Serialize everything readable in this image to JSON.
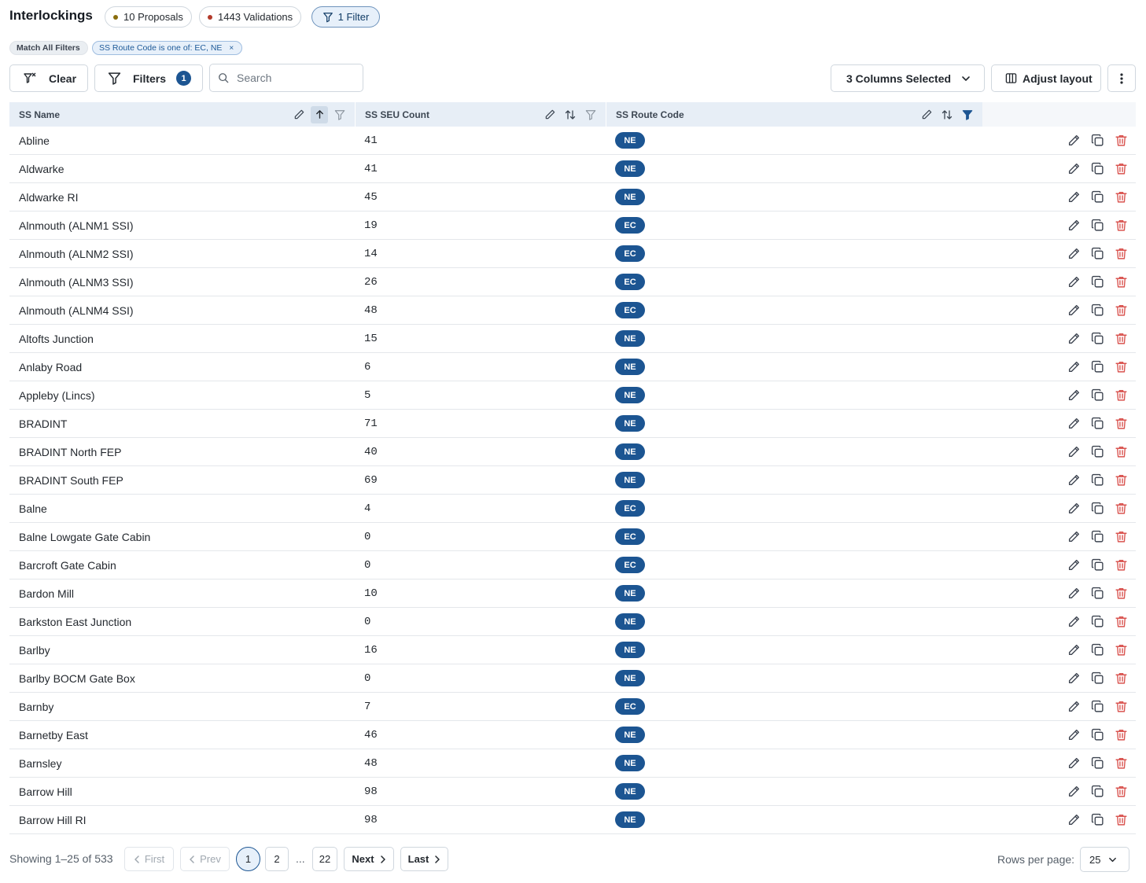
{
  "header": {
    "title": "Interlockings",
    "proposals_label": "10 Proposals",
    "proposals_color": "#8a6d0c",
    "validations_label": "1443 Validations",
    "validations_color": "#b33a2a",
    "filter_chip_label": "1 Filter"
  },
  "filter_pills": {
    "match_label": "Match All Filters",
    "active_filter": "SS Route Code is one of: EC, NE",
    "remove_symbol": "×"
  },
  "toolbar": {
    "clear_label": "Clear",
    "filters_label": "Filters",
    "filters_count": "1",
    "search_placeholder": "Search",
    "columns_label": "3 Columns Selected",
    "adjust_layout_label": "Adjust layout"
  },
  "table": {
    "columns": [
      "SS Name",
      "SS SEU Count",
      "SS Route Code"
    ],
    "accent_color": "#1c5592",
    "delete_color": "#d9534f",
    "rows": [
      {
        "name": "Abline",
        "count": "41",
        "route": "NE"
      },
      {
        "name": "Aldwarke",
        "count": "41",
        "route": "NE"
      },
      {
        "name": "Aldwarke RI",
        "count": "45",
        "route": "NE"
      },
      {
        "name": "Alnmouth (ALNM1 SSI)",
        "count": "19",
        "route": "EC"
      },
      {
        "name": "Alnmouth (ALNM2 SSI)",
        "count": "14",
        "route": "EC"
      },
      {
        "name": "Alnmouth (ALNM3 SSI)",
        "count": "26",
        "route": "EC"
      },
      {
        "name": "Alnmouth (ALNM4 SSI)",
        "count": "48",
        "route": "EC"
      },
      {
        "name": "Altofts Junction",
        "count": "15",
        "route": "NE"
      },
      {
        "name": "Anlaby Road",
        "count": "6",
        "route": "NE"
      },
      {
        "name": "Appleby (Lincs)",
        "count": "5",
        "route": "NE"
      },
      {
        "name": "BRADINT",
        "count": "71",
        "route": "NE"
      },
      {
        "name": "BRADINT North FEP",
        "count": "40",
        "route": "NE"
      },
      {
        "name": "BRADINT South FEP",
        "count": "69",
        "route": "NE"
      },
      {
        "name": "Balne",
        "count": "4",
        "route": "EC"
      },
      {
        "name": "Balne Lowgate Gate Cabin",
        "count": "0",
        "route": "EC"
      },
      {
        "name": "Barcroft Gate Cabin",
        "count": "0",
        "route": "EC"
      },
      {
        "name": "Bardon Mill",
        "count": "10",
        "route": "NE"
      },
      {
        "name": "Barkston East Junction",
        "count": "0",
        "route": "NE"
      },
      {
        "name": "Barlby",
        "count": "16",
        "route": "NE"
      },
      {
        "name": "Barlby BOCM Gate Box",
        "count": "0",
        "route": "NE"
      },
      {
        "name": "Barnby",
        "count": "7",
        "route": "EC"
      },
      {
        "name": "Barnetby East",
        "count": "46",
        "route": "NE"
      },
      {
        "name": "Barnsley",
        "count": "48",
        "route": "NE"
      },
      {
        "name": "Barrow Hill",
        "count": "98",
        "route": "NE"
      },
      {
        "name": "Barrow Hill RI",
        "count": "98",
        "route": "NE"
      }
    ]
  },
  "pagination": {
    "showing": "Showing 1–25 of 533",
    "first_label": "First",
    "prev_label": "Prev",
    "pages": [
      "1",
      "2",
      "22"
    ],
    "ellipsis": "...",
    "next_label": "Next",
    "last_label": "Last",
    "rows_per_page_label": "Rows per page:",
    "rows_per_page_value": "25"
  }
}
